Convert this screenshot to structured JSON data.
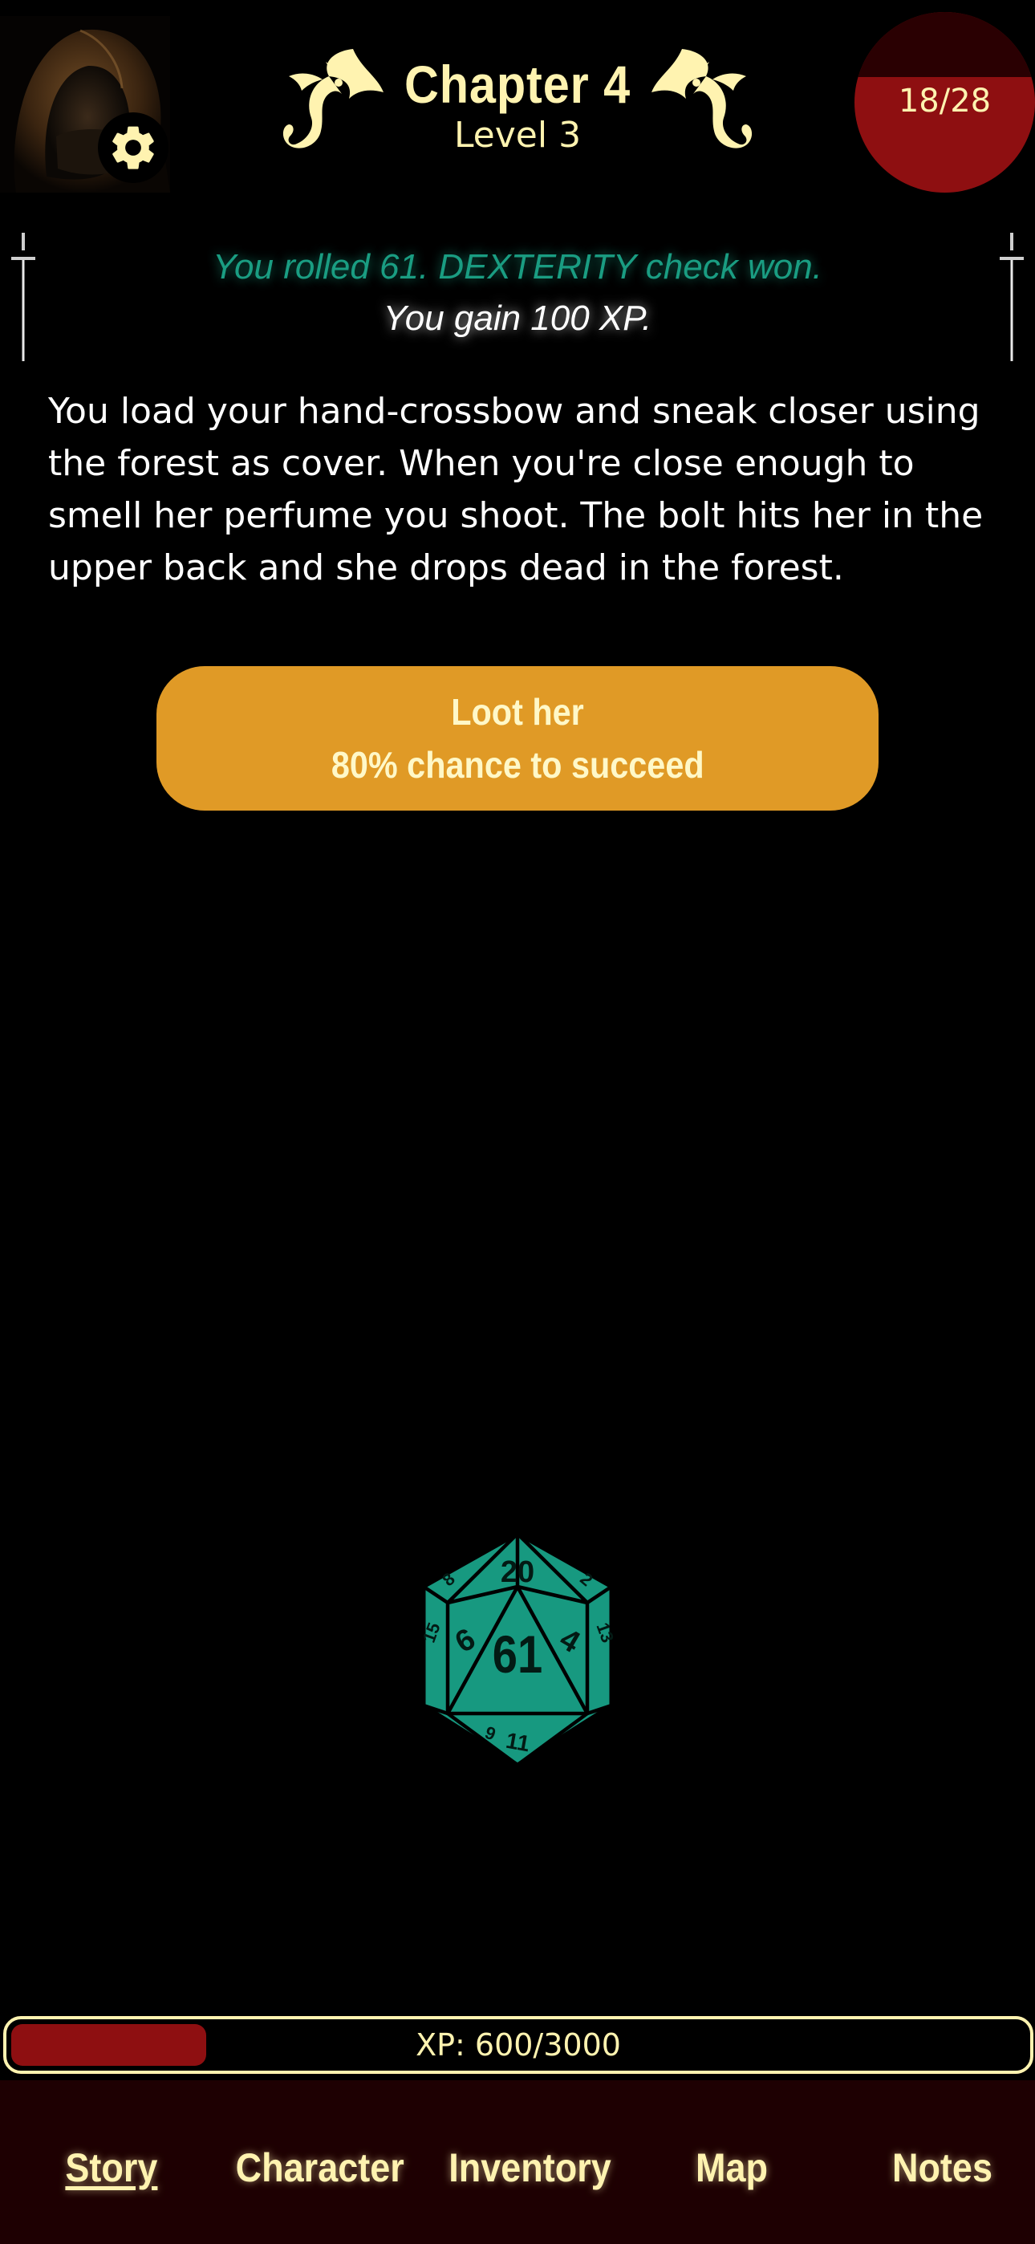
{
  "header": {
    "chapter": "Chapter 4",
    "level": "Level 3",
    "hp": "18/28",
    "hp_fraction": 0.64
  },
  "roll": {
    "result_text": "You rolled 61. DEXTERITY check won.",
    "xp_text": "You gain 100 XP."
  },
  "story": {
    "text": "You load your hand-crossbow and sneak closer using the forest as cover. When you're close enough to smell her perfume you shoot. The bolt hits her in the upper back and she drops dead in the forest."
  },
  "choice": {
    "line1": "Loot her",
    "line2": "80% chance to succeed"
  },
  "die": {
    "value": "61",
    "face_top": "20",
    "face_left": "6",
    "face_right": "4",
    "face_bottom": "11",
    "corner_tl": "8",
    "corner_tr": "2",
    "corner_ml": "15",
    "corner_mr": "13",
    "corner_bl": "9",
    "color": "#179980"
  },
  "xp": {
    "label": "XP: 600/3000",
    "fraction": 0.2
  },
  "nav": {
    "story": "Story",
    "character": "Character",
    "inventory": "Inventory",
    "map": "Map",
    "notes": "Notes"
  },
  "colors": {
    "accent_gold": "#fff3b0",
    "button_orange": "#e09a26",
    "hp_red": "#8e0f11",
    "roll_teal": "#1a9d82",
    "nav_bg": "#1e0002"
  }
}
